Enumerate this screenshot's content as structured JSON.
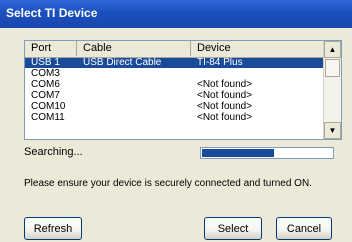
{
  "window": {
    "title": "Select TI Device"
  },
  "list": {
    "columns": [
      "Port",
      "Cable",
      "Device"
    ],
    "rows": [
      {
        "port": "USB 1",
        "cable": "USB Direct Cable",
        "device": "TI-84 Plus",
        "selected": true
      },
      {
        "port": "COM3",
        "cable": "",
        "device": "",
        "selected": false
      },
      {
        "port": "COM6",
        "cable": "",
        "device": "<Not found>",
        "selected": false
      },
      {
        "port": "COM7",
        "cable": "",
        "device": "<Not found>",
        "selected": false
      },
      {
        "port": "COM10",
        "cable": "",
        "device": "<Not found>",
        "selected": false
      },
      {
        "port": "COM11",
        "cable": "",
        "device": "<Not found>",
        "selected": false
      }
    ]
  },
  "status": {
    "text": "Searching...",
    "progress": 0.55
  },
  "message": "Please ensure your device is securely connected and turned ON.",
  "buttons": {
    "refresh": "Refresh",
    "select": "Select",
    "cancel": "Cancel"
  },
  "colors": {
    "titlebar": "#1b4fbe",
    "selection": "#1a4a9a",
    "progress": "#1a4a9a",
    "dialog": "#ece9d8"
  }
}
